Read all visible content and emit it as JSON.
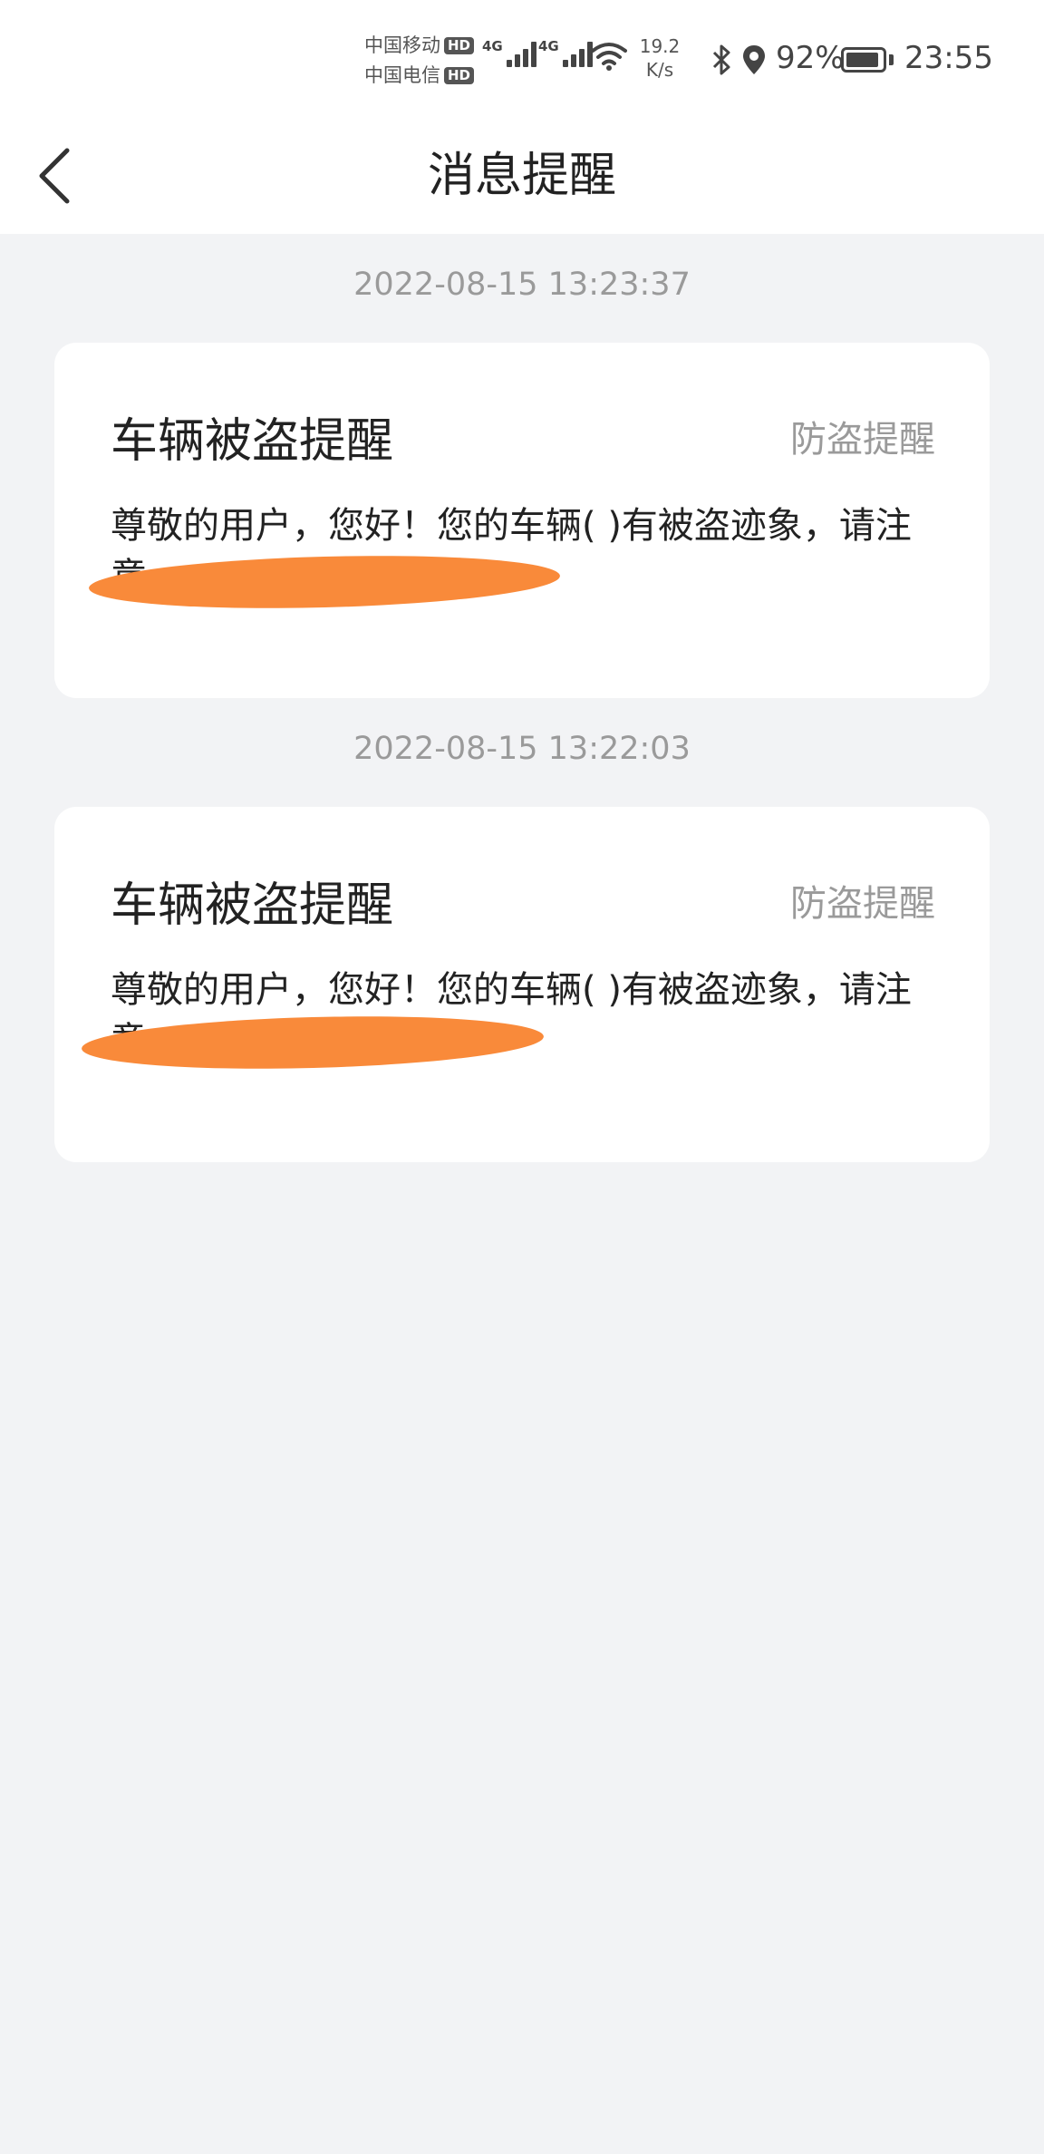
{
  "status_bar": {
    "carrier1": "中国移动",
    "carrier2": "中国电信",
    "hd_badge": "HD",
    "network1": "4G",
    "network2": "4G",
    "speed_value": "19.2",
    "speed_unit": "K/s",
    "battery_percent": "92%",
    "battery_level": 0.92,
    "time": "23:55",
    "icons": [
      "signal-icon",
      "wifi-icon",
      "bluetooth-icon",
      "location-icon",
      "battery-icon"
    ]
  },
  "header": {
    "back_icon": "chevron-left-icon",
    "title": "消息提醒"
  },
  "messages": [
    {
      "timestamp": "2022-08-15 13:23:37",
      "title": "车辆被盗提醒",
      "tag": "防盗提醒",
      "body": "尊敬的用户，您好！您的车辆( )有被盗迹象，请注意"
    },
    {
      "timestamp": "2022-08-15 13:22:03",
      "title": "车辆被盗提醒",
      "tag": "防盗提醒",
      "body": "尊敬的用户，您好！您的车辆( )有被盗迹象，请注意"
    }
  ],
  "colors": {
    "background": "#f2f3f5",
    "card": "#ffffff",
    "redaction": "#f98a3a",
    "muted_text": "#9a9a9a"
  }
}
